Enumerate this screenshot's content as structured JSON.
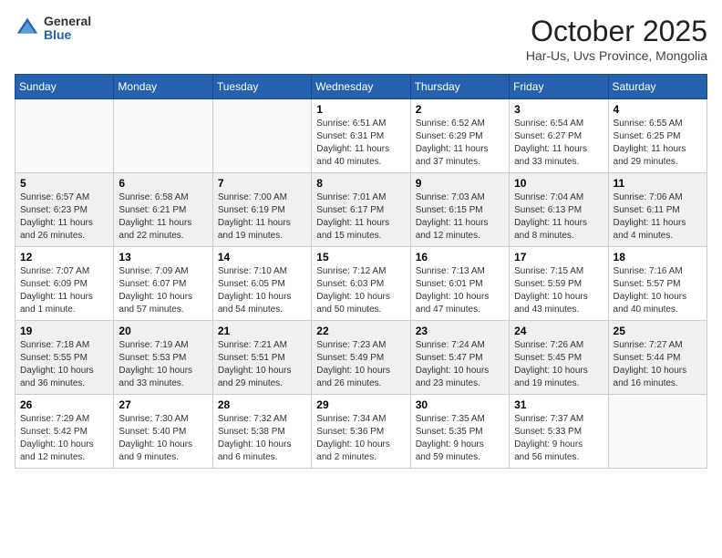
{
  "header": {
    "logo_general": "General",
    "logo_blue": "Blue",
    "month_title": "October 2025",
    "location": "Har-Us, Uvs Province, Mongolia"
  },
  "weekdays": [
    "Sunday",
    "Monday",
    "Tuesday",
    "Wednesday",
    "Thursday",
    "Friday",
    "Saturday"
  ],
  "weeks": [
    {
      "days": [
        {
          "number": "",
          "info": ""
        },
        {
          "number": "",
          "info": ""
        },
        {
          "number": "",
          "info": ""
        },
        {
          "number": "1",
          "info": "Sunrise: 6:51 AM\nSunset: 6:31 PM\nDaylight: 11 hours\nand 40 minutes."
        },
        {
          "number": "2",
          "info": "Sunrise: 6:52 AM\nSunset: 6:29 PM\nDaylight: 11 hours\nand 37 minutes."
        },
        {
          "number": "3",
          "info": "Sunrise: 6:54 AM\nSunset: 6:27 PM\nDaylight: 11 hours\nand 33 minutes."
        },
        {
          "number": "4",
          "info": "Sunrise: 6:55 AM\nSunset: 6:25 PM\nDaylight: 11 hours\nand 29 minutes."
        }
      ]
    },
    {
      "days": [
        {
          "number": "5",
          "info": "Sunrise: 6:57 AM\nSunset: 6:23 PM\nDaylight: 11 hours\nand 26 minutes."
        },
        {
          "number": "6",
          "info": "Sunrise: 6:58 AM\nSunset: 6:21 PM\nDaylight: 11 hours\nand 22 minutes."
        },
        {
          "number": "7",
          "info": "Sunrise: 7:00 AM\nSunset: 6:19 PM\nDaylight: 11 hours\nand 19 minutes."
        },
        {
          "number": "8",
          "info": "Sunrise: 7:01 AM\nSunset: 6:17 PM\nDaylight: 11 hours\nand 15 minutes."
        },
        {
          "number": "9",
          "info": "Sunrise: 7:03 AM\nSunset: 6:15 PM\nDaylight: 11 hours\nand 12 minutes."
        },
        {
          "number": "10",
          "info": "Sunrise: 7:04 AM\nSunset: 6:13 PM\nDaylight: 11 hours\nand 8 minutes."
        },
        {
          "number": "11",
          "info": "Sunrise: 7:06 AM\nSunset: 6:11 PM\nDaylight: 11 hours\nand 4 minutes."
        }
      ]
    },
    {
      "days": [
        {
          "number": "12",
          "info": "Sunrise: 7:07 AM\nSunset: 6:09 PM\nDaylight: 11 hours\nand 1 minute."
        },
        {
          "number": "13",
          "info": "Sunrise: 7:09 AM\nSunset: 6:07 PM\nDaylight: 10 hours\nand 57 minutes."
        },
        {
          "number": "14",
          "info": "Sunrise: 7:10 AM\nSunset: 6:05 PM\nDaylight: 10 hours\nand 54 minutes."
        },
        {
          "number": "15",
          "info": "Sunrise: 7:12 AM\nSunset: 6:03 PM\nDaylight: 10 hours\nand 50 minutes."
        },
        {
          "number": "16",
          "info": "Sunrise: 7:13 AM\nSunset: 6:01 PM\nDaylight: 10 hours\nand 47 minutes."
        },
        {
          "number": "17",
          "info": "Sunrise: 7:15 AM\nSunset: 5:59 PM\nDaylight: 10 hours\nand 43 minutes."
        },
        {
          "number": "18",
          "info": "Sunrise: 7:16 AM\nSunset: 5:57 PM\nDaylight: 10 hours\nand 40 minutes."
        }
      ]
    },
    {
      "days": [
        {
          "number": "19",
          "info": "Sunrise: 7:18 AM\nSunset: 5:55 PM\nDaylight: 10 hours\nand 36 minutes."
        },
        {
          "number": "20",
          "info": "Sunrise: 7:19 AM\nSunset: 5:53 PM\nDaylight: 10 hours\nand 33 minutes."
        },
        {
          "number": "21",
          "info": "Sunrise: 7:21 AM\nSunset: 5:51 PM\nDaylight: 10 hours\nand 29 minutes."
        },
        {
          "number": "22",
          "info": "Sunrise: 7:23 AM\nSunset: 5:49 PM\nDaylight: 10 hours\nand 26 minutes."
        },
        {
          "number": "23",
          "info": "Sunrise: 7:24 AM\nSunset: 5:47 PM\nDaylight: 10 hours\nand 23 minutes."
        },
        {
          "number": "24",
          "info": "Sunrise: 7:26 AM\nSunset: 5:45 PM\nDaylight: 10 hours\nand 19 minutes."
        },
        {
          "number": "25",
          "info": "Sunrise: 7:27 AM\nSunset: 5:44 PM\nDaylight: 10 hours\nand 16 minutes."
        }
      ]
    },
    {
      "days": [
        {
          "number": "26",
          "info": "Sunrise: 7:29 AM\nSunset: 5:42 PM\nDaylight: 10 hours\nand 12 minutes."
        },
        {
          "number": "27",
          "info": "Sunrise: 7:30 AM\nSunset: 5:40 PM\nDaylight: 10 hours\nand 9 minutes."
        },
        {
          "number": "28",
          "info": "Sunrise: 7:32 AM\nSunset: 5:38 PM\nDaylight: 10 hours\nand 6 minutes."
        },
        {
          "number": "29",
          "info": "Sunrise: 7:34 AM\nSunset: 5:36 PM\nDaylight: 10 hours\nand 2 minutes."
        },
        {
          "number": "30",
          "info": "Sunrise: 7:35 AM\nSunset: 5:35 PM\nDaylight: 9 hours\nand 59 minutes."
        },
        {
          "number": "31",
          "info": "Sunrise: 7:37 AM\nSunset: 5:33 PM\nDaylight: 9 hours\nand 56 minutes."
        },
        {
          "number": "",
          "info": ""
        }
      ]
    }
  ]
}
